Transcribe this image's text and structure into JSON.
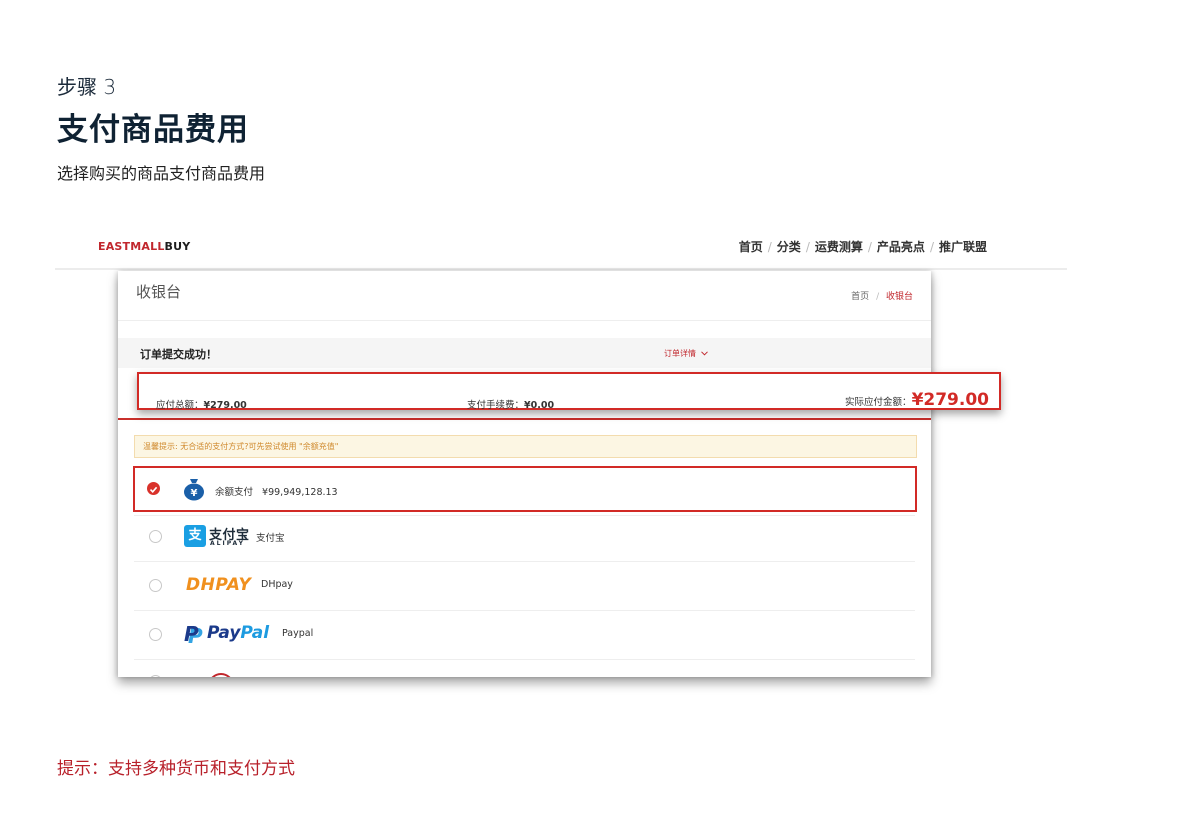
{
  "doc": {
    "step": "步骤 3",
    "title": "支付商品费用",
    "subtitle": "选择购买的商品支付商品费用",
    "hint": "提示：支持多种货币和支付方式"
  },
  "site": {
    "logo_part1": "EASTMALL",
    "logo_part2": "BUY",
    "nav": [
      "首页",
      "分类",
      "运费测算",
      "产品亮点",
      "推广联盟"
    ],
    "nav_sep": "/"
  },
  "cashier": {
    "title": "收银台",
    "breadcrumb": [
      "首页",
      "收银台"
    ],
    "order_success": "订单提交成功！",
    "order_detail": "订单详情",
    "total_label": "应付总额：",
    "total_value": "¥279.00",
    "fee_label": "支付手续费：",
    "fee_value": "¥0.00",
    "actual_label": "实际应付金额：",
    "actual_value": "¥279.00",
    "tip": "温馨提示: 无合适的支付方式?可先尝试使用 \"余额充值\"",
    "payments": [
      {
        "label": "余额支付",
        "extra": "¥99,949,128.13",
        "selected": true,
        "icon": "money-bag-icon"
      },
      {
        "label": "支付宝",
        "logo_zh": "支付宝",
        "logo_en": "ALIPAY",
        "selected": false,
        "icon": "alipay-icon"
      },
      {
        "label": "DHpay",
        "logo": "DHPAY",
        "selected": false,
        "icon": "dhpay-icon"
      },
      {
        "label": "Paypal",
        "logo_a": "Pay",
        "logo_b": "Pal",
        "selected": false,
        "icon": "paypal-icon"
      }
    ],
    "accent_color": "#d22a26"
  }
}
